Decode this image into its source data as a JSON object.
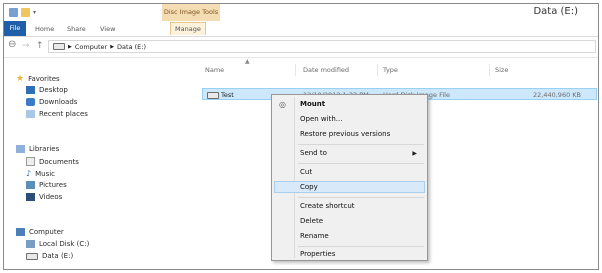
{
  "window": {
    "title": "Data (E:)",
    "context_group": "Disc Image Tools"
  },
  "ribbon": {
    "tabs": [
      "File",
      "Home",
      "Share",
      "View",
      "Manage"
    ]
  },
  "address": {
    "back_icon": "back-arrow-icon",
    "forward_icon": "forward-arrow-icon",
    "up_icon": "up-arrow-icon",
    "crumbs": [
      "Computer",
      "Data (E:)"
    ]
  },
  "sidebar": {
    "favorites": {
      "label": "Favorites",
      "items": [
        "Desktop",
        "Downloads",
        "Recent places"
      ]
    },
    "libraries": {
      "label": "Libraries",
      "items": [
        "Documents",
        "Music",
        "Pictures",
        "Videos"
      ]
    },
    "computer": {
      "label": "Computer",
      "items": [
        "Local Disk (C:)",
        "Data (E:)"
      ]
    }
  },
  "columns": [
    "Name",
    "Date modified",
    "Type",
    "Size"
  ],
  "files": [
    {
      "name": "Test",
      "date": "12/19/2012 1:32 PM",
      "type": "Hard Disk Image File",
      "size": "22,440,960 KB"
    }
  ],
  "context_menu": {
    "items": [
      "Mount",
      "Open with...",
      "Restore previous versions",
      "Send to",
      "Cut",
      "Copy",
      "Create shortcut",
      "Delete",
      "Rename",
      "Properties"
    ]
  },
  "colors": {
    "file_tab": "#1f5ea8",
    "context_tab": "#f5ddb3",
    "selection": "#cde8fb",
    "menu_highlight": "#d8eafa"
  }
}
